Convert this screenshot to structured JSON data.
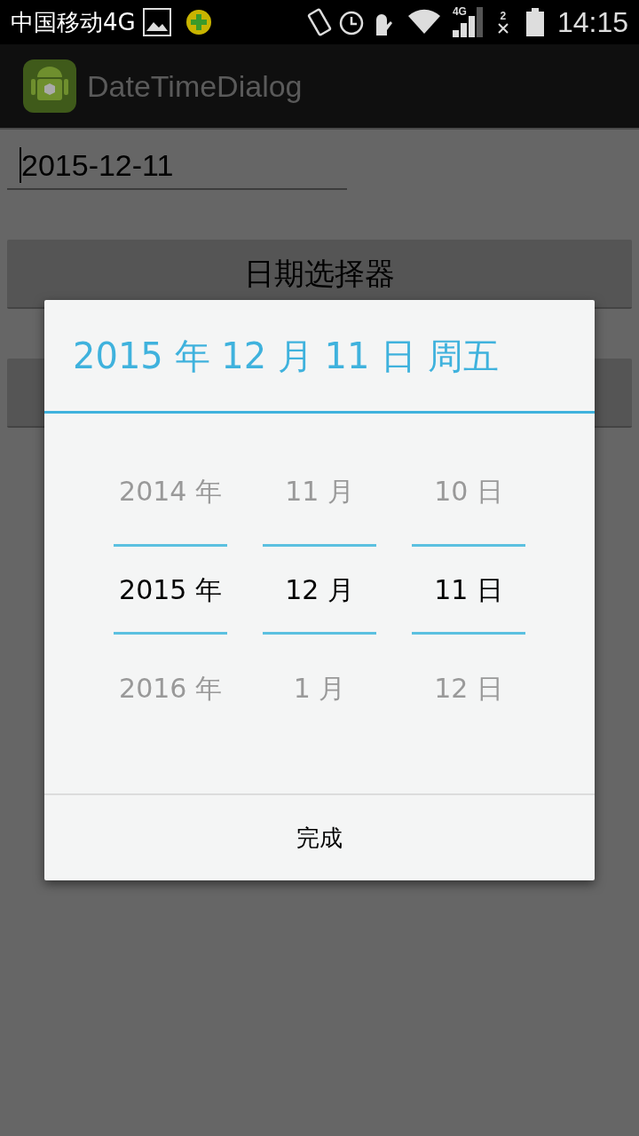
{
  "status_bar": {
    "carrier": "中国移动4G",
    "network": "4G",
    "sim": "2",
    "time": "14:15"
  },
  "app_bar": {
    "title": "DateTimeDialog"
  },
  "date_field": {
    "value": "2015-12-11"
  },
  "buttons": [
    {
      "kind": "text",
      "label": "日期选择器"
    },
    {
      "kind": "blank"
    }
  ],
  "dialog": {
    "title": "2015 年 12 月 11 日 周五",
    "columns": [
      {
        "items": [
          {
            "text": "2014 年",
            "selected": false
          },
          {
            "text": "2015 年",
            "selected": true
          },
          {
            "text": "2016 年",
            "selected": false
          }
        ]
      },
      {
        "items": [
          {
            "text": "11 月",
            "selected": false
          },
          {
            "text": "12 月",
            "selected": true
          },
          {
            "text": "1 月",
            "selected": false
          }
        ]
      },
      {
        "items": [
          {
            "text": "10 日",
            "selected": false
          },
          {
            "text": "11 日",
            "selected": true
          },
          {
            "text": "12 日",
            "selected": false
          }
        ]
      }
    ],
    "done_button": "完成"
  }
}
